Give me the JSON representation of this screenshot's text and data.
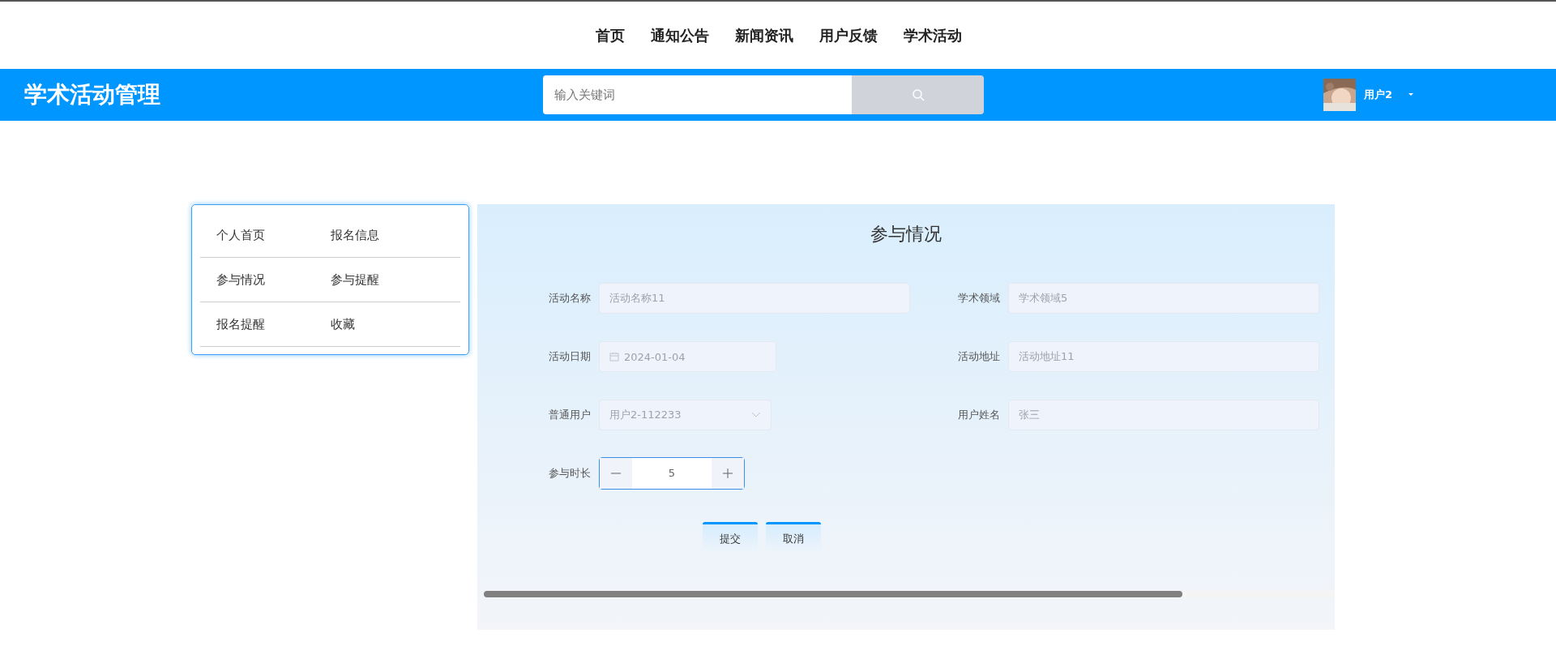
{
  "top_nav": [
    {
      "label": "首页",
      "selected": false
    },
    {
      "label": "通知公告",
      "selected": false
    },
    {
      "label": "新闻资讯",
      "selected": false
    },
    {
      "label": "用户反馈",
      "selected": false
    },
    {
      "label": "学术活动",
      "selected": false
    }
  ],
  "header": {
    "title": "学术活动管理",
    "search": {
      "placeholder": "输入关键词"
    },
    "user": {
      "name": "用户2"
    }
  },
  "sidebar": {
    "items": [
      {
        "label": "个人首页"
      },
      {
        "label": "报名信息"
      },
      {
        "label": "参与情况"
      },
      {
        "label": "参与提醒"
      },
      {
        "label": "报名提醒"
      },
      {
        "label": "收藏"
      }
    ]
  },
  "form": {
    "title": "参与情况",
    "fields": [
      {
        "label": "活动名称",
        "kind": "text",
        "placeholder": "活动名称11"
      },
      {
        "label": "学术领域",
        "kind": "text",
        "placeholder": "学术领域5"
      },
      {
        "label": "活动日期",
        "kind": "date",
        "value": "2024-01-04"
      },
      {
        "label": "活动地址",
        "kind": "text",
        "placeholder": "活动地址11"
      },
      {
        "label": "普通用户",
        "kind": "select",
        "placeholder": "用户2-112233"
      },
      {
        "label": "用户姓名",
        "kind": "text",
        "placeholder": "张三"
      },
      {
        "label": "参与时长",
        "kind": "number",
        "value": "5"
      }
    ],
    "buttons": [
      "提交",
      "取消"
    ]
  }
}
